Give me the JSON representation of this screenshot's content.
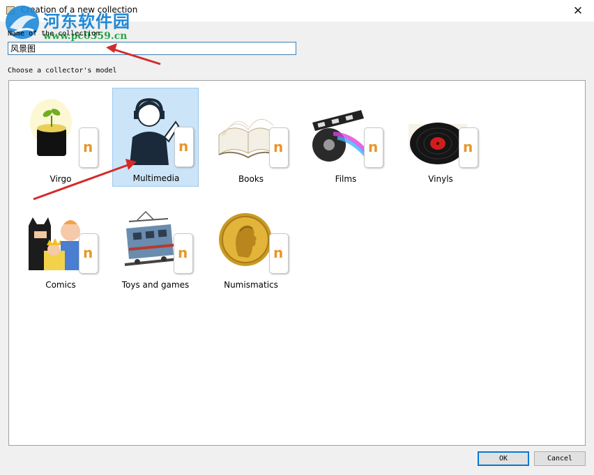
{
  "window": {
    "title": "Creation of a new collection",
    "close_symbol": "✕"
  },
  "watermark": {
    "line1": "河东软件园",
    "line2": "www.pc0359.cn"
  },
  "form": {
    "name_label": "Name of the collection",
    "name_value": "风景图",
    "model_label": "Choose a collector's model"
  },
  "models": [
    {
      "label": "Virgo",
      "icon": "plant-pot-icon",
      "selected": false
    },
    {
      "label": "Multimedia",
      "icon": "headphones-person-icon",
      "selected": true
    },
    {
      "label": "Books",
      "icon": "open-book-icon",
      "selected": false
    },
    {
      "label": "Films",
      "icon": "film-reel-icon",
      "selected": false
    },
    {
      "label": "Vinyls",
      "icon": "vinyl-record-icon",
      "selected": false
    },
    {
      "label": "Comics",
      "icon": "comic-characters-icon",
      "selected": false
    },
    {
      "label": "Toys and games",
      "icon": "toy-train-icon",
      "selected": false
    },
    {
      "label": "Numismatics",
      "icon": "gold-coin-icon",
      "selected": false
    }
  ],
  "buttons": {
    "ok": "OK",
    "cancel": "Cancel"
  },
  "colors": {
    "selection": "#cce4f7",
    "accent": "#0078d7",
    "badge_n": "#e8962a",
    "annotation_arrow": "#d42a2a"
  }
}
